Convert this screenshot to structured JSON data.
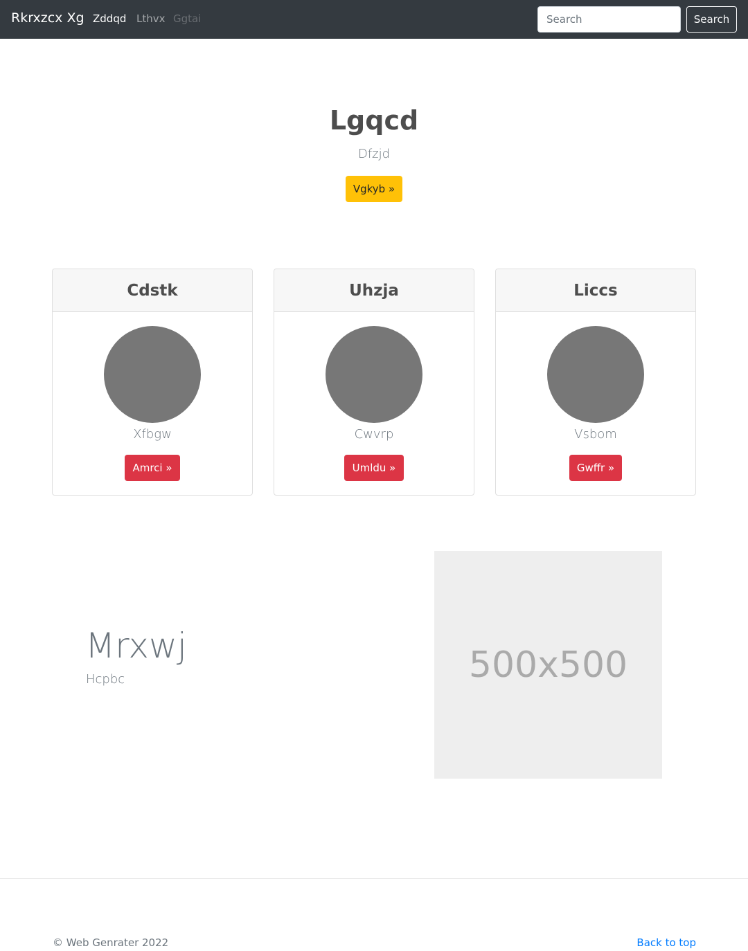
{
  "navbar": {
    "brand": "Rkrxzcx Xg",
    "links": [
      {
        "label": "Zddqd",
        "state": "active"
      },
      {
        "label": "Lthvx",
        "state": "normal"
      },
      {
        "label": "Ggtai",
        "state": "disabled"
      }
    ],
    "search_placeholder": "Search",
    "search_button": "Search"
  },
  "hero": {
    "title": "Lgqcd",
    "subtitle": "Dfzjd",
    "button": "Vgkyb »"
  },
  "cards": [
    {
      "header": "Cdstk",
      "text": "Xfbgw",
      "button": "Amrci »"
    },
    {
      "header": "Uhzja",
      "text": "Cwvrp",
      "button": "Umldu »"
    },
    {
      "header": "Liccs",
      "text": "Vsbom",
      "button": "Gwffr »"
    }
  ],
  "feature": {
    "title": "Mrxwj",
    "subtitle": "Hcpbc",
    "image_label": "500x500"
  },
  "footer": {
    "copyright": "© Web Genrater 2022",
    "back_to_top": "Back to top"
  },
  "colors": {
    "navbar_bg": "#343a40",
    "warning": "#ffc107",
    "danger": "#dc3545",
    "link": "#007bff",
    "avatar": "#777777"
  }
}
